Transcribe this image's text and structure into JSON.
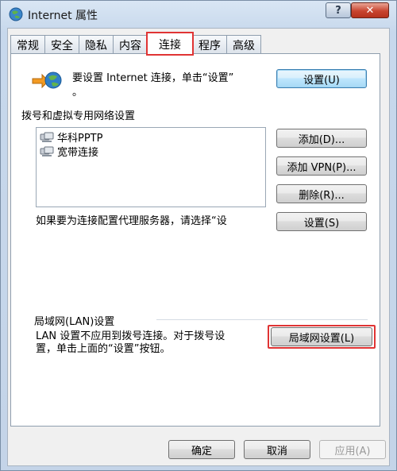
{
  "window": {
    "title": "Internet 属性",
    "help_label": "?",
    "close_label": "✕"
  },
  "tabs": [
    {
      "label": "常规"
    },
    {
      "label": "安全"
    },
    {
      "label": "隐私"
    },
    {
      "label": "内容"
    },
    {
      "label": "连接",
      "active": true
    },
    {
      "label": "程序"
    },
    {
      "label": "高级"
    }
  ],
  "setup": {
    "text_line1": "要设置 Internet 连接，单击“设置”",
    "text_line2": "。",
    "button_label": "设置(U)"
  },
  "dialup": {
    "heading": "拨号和虚拟专用网络设置",
    "connections": [
      {
        "label": "华科PPTP"
      },
      {
        "label": "宽带连接"
      }
    ],
    "add_label": "添加(D)...",
    "add_vpn_label": "添加 VPN(P)...",
    "remove_label": "删除(R)...",
    "proxy_text": "如果要为连接配置代理服务器，请选择“设",
    "settings_label": "设置(S)"
  },
  "lan": {
    "heading": "局域网(LAN)设置",
    "text_line1": "LAN 设置不应用到拨号连接。对于拨号设",
    "text_line2": "置，单击上面的“设置”按钮。",
    "button_label": "局域网设置(L)"
  },
  "footer": {
    "ok_label": "确定",
    "cancel_label": "取消",
    "apply_label": "应用(A)"
  }
}
